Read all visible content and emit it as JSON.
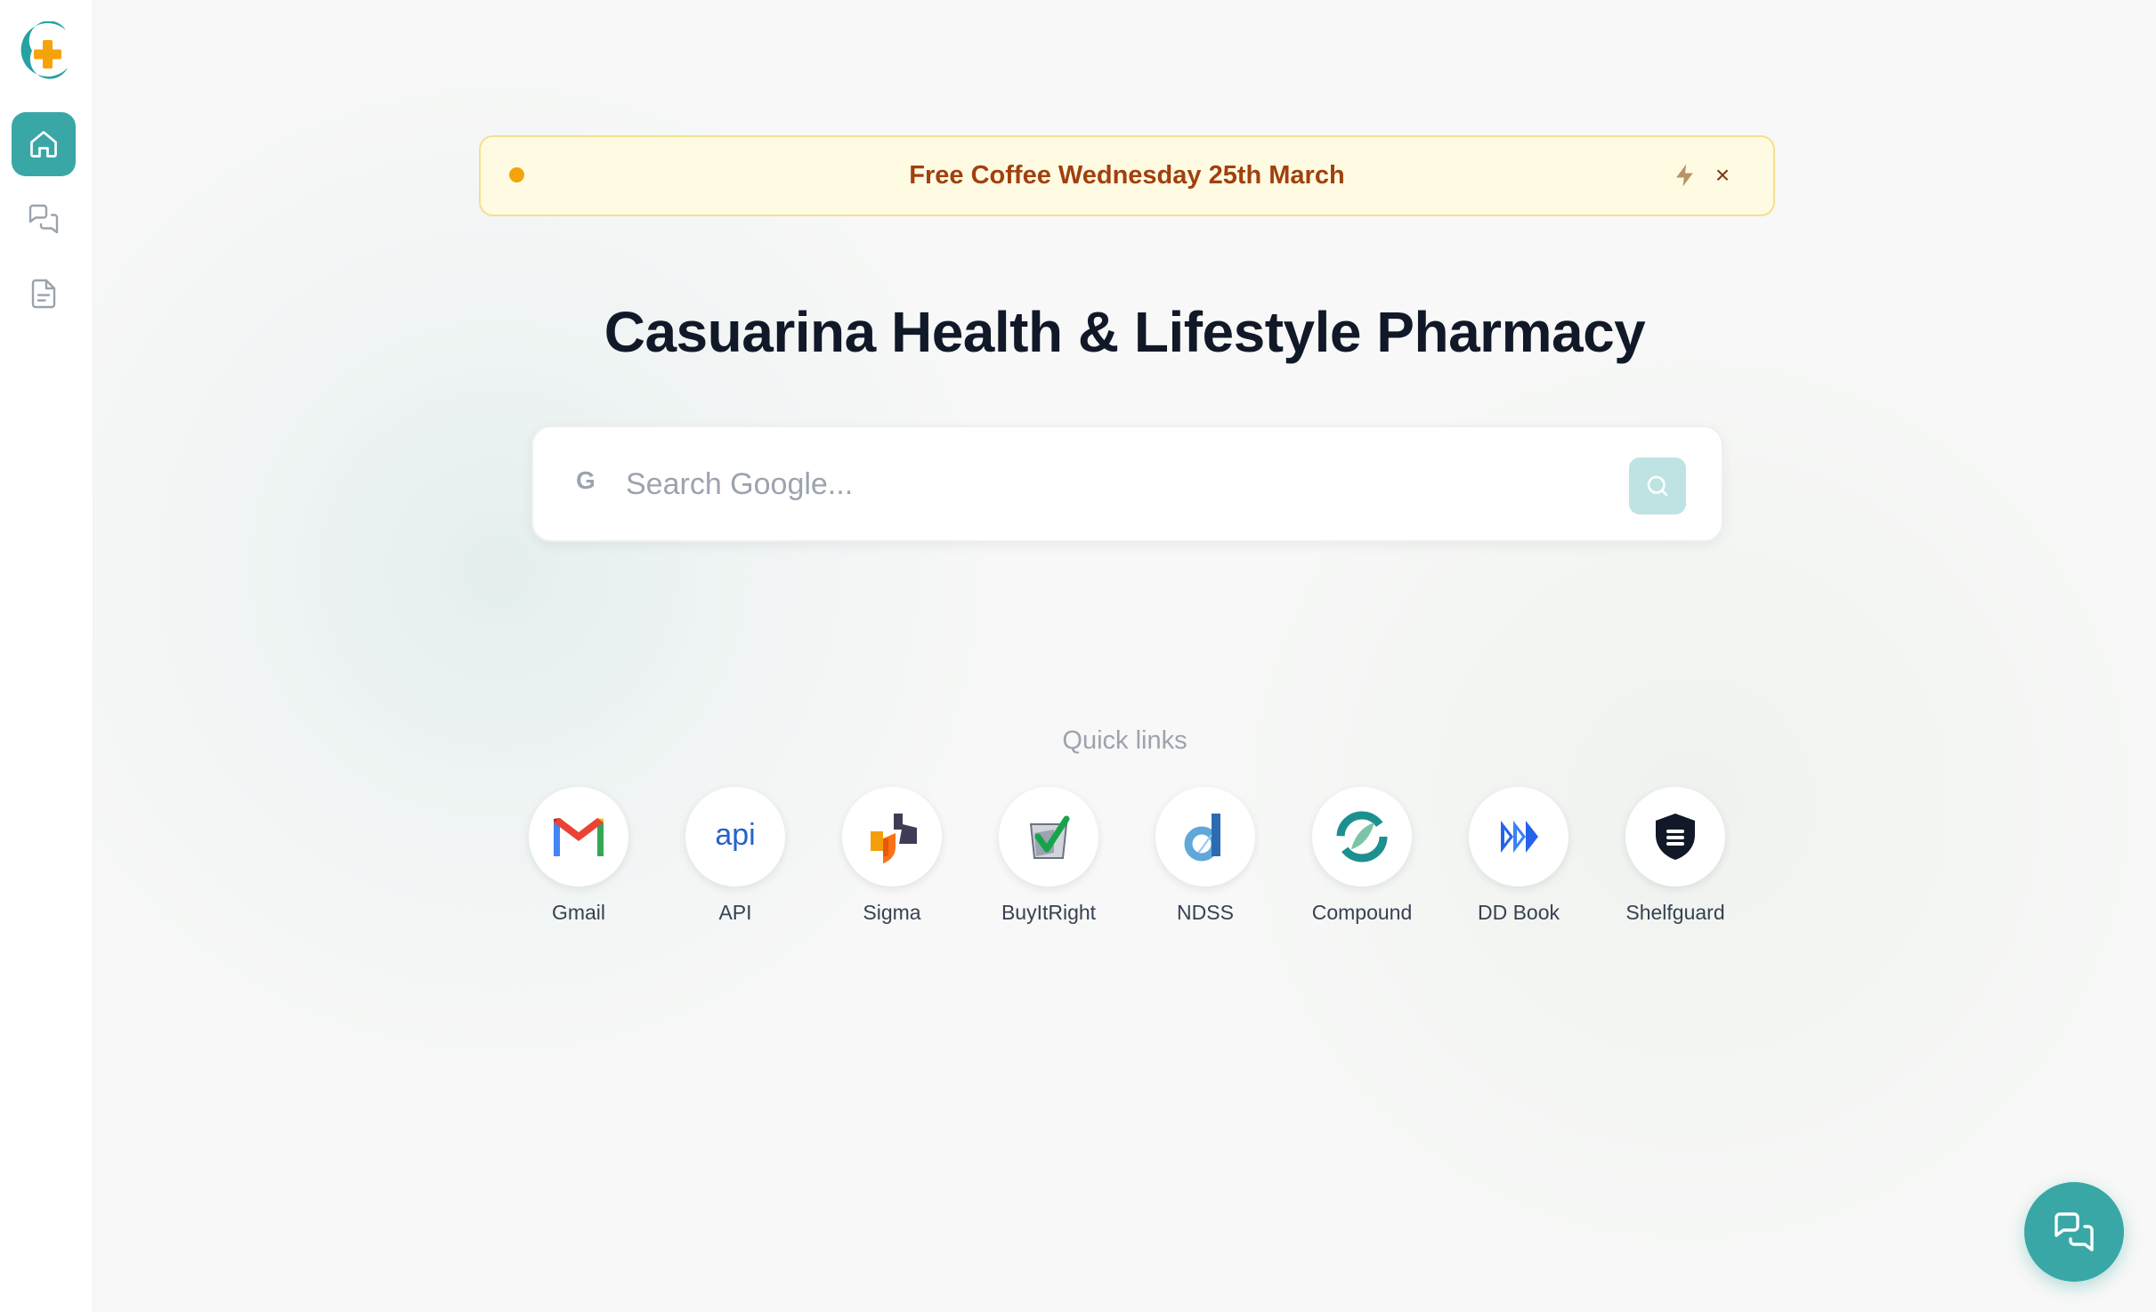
{
  "sidebar": {
    "logo_icon": "casuarina-logo",
    "items": [
      {
        "name": "home",
        "icon": "home-icon",
        "active": true
      },
      {
        "name": "chat",
        "icon": "chat-icon",
        "active": false
      },
      {
        "name": "document",
        "icon": "document-icon",
        "active": false
      }
    ]
  },
  "banner": {
    "text": "Free Coffee Wednesday 25th March",
    "bolt_icon": "bolt-icon",
    "close_label": "×"
  },
  "page": {
    "title": "Casuarina Health & Lifestyle Pharmacy"
  },
  "search": {
    "prefix": "G",
    "placeholder": "Search Google...",
    "value": "",
    "button_icon": "search-icon"
  },
  "quick_links": {
    "heading": "Quick links",
    "items": [
      {
        "label": "Gmail",
        "icon": "gmail-icon"
      },
      {
        "label": "API",
        "icon": "api-icon"
      },
      {
        "label": "Sigma",
        "icon": "sigma-icon"
      },
      {
        "label": "BuyItRight",
        "icon": "buyitright-icon"
      },
      {
        "label": "NDSS",
        "icon": "ndss-icon"
      },
      {
        "label": "Compound",
        "icon": "compound-icon"
      },
      {
        "label": "DD Book",
        "icon": "dd-book-icon"
      },
      {
        "label": "Shelfguard",
        "icon": "shelfguard-icon"
      }
    ]
  },
  "chat_fab": {
    "icon": "chat-icon"
  },
  "colors": {
    "accent": "#3aa7a7",
    "banner_bg": "#fffbe3",
    "banner_text": "#a0410d",
    "banner_dot": "#f5a30b",
    "title": "#111827"
  }
}
